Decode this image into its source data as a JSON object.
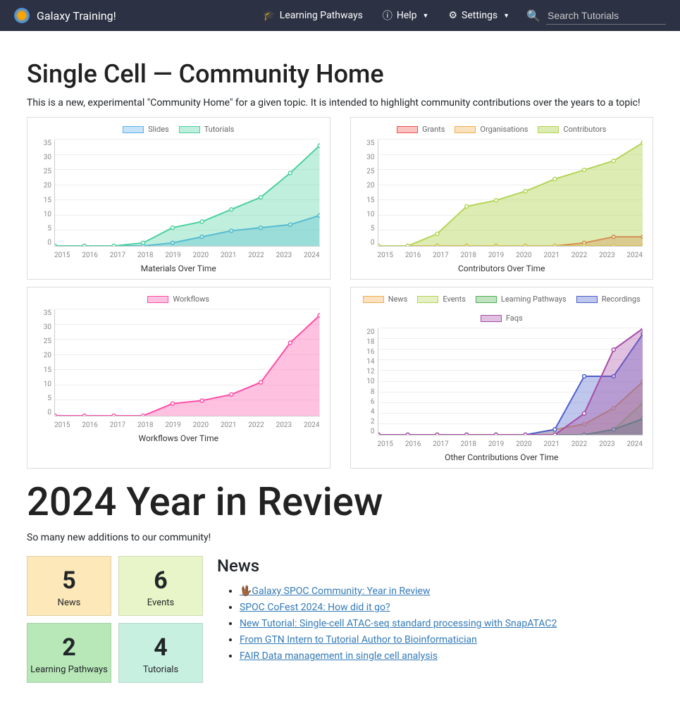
{
  "nav": {
    "brand": "Galaxy Training!",
    "pathways": "Learning Pathways",
    "help": "Help",
    "settings": "Settings",
    "search_placeholder": "Search Tutorials"
  },
  "page": {
    "title": "Single Cell — Community Home",
    "intro": "This is a new, experimental \"Community Home\" for a given topic. It is intended to highlight community contributions over the years to a topic!"
  },
  "chart_data": [
    {
      "type": "area",
      "title": "Materials Over Time",
      "x": [
        2015,
        2016,
        2017,
        2018,
        2019,
        2020,
        2021,
        2022,
        2023,
        2024
      ],
      "ymax": 35,
      "series": [
        {
          "name": "Slides",
          "color": "#5bb0e8",
          "fill": "rgba(91,176,232,0.35)",
          "values": [
            0,
            0,
            0,
            0,
            1,
            3,
            5,
            6,
            7,
            10
          ]
        },
        {
          "name": "Tutorials",
          "color": "#4bd1a0",
          "fill": "rgba(75,209,160,0.35)",
          "values": [
            0,
            0,
            0,
            1,
            6,
            8,
            12,
            16,
            24,
            33
          ]
        }
      ]
    },
    {
      "type": "area",
      "title": "Contributors Over Time",
      "x": [
        2015,
        2016,
        2017,
        2018,
        2019,
        2020,
        2021,
        2022,
        2023,
        2024
      ],
      "ymax": 35,
      "series": [
        {
          "name": "Grants",
          "color": "#ef5350",
          "fill": "rgba(239,83,80,0.35)",
          "values": [
            0,
            0,
            0,
            0,
            0,
            0,
            0,
            1,
            3,
            3
          ]
        },
        {
          "name": "Organisations",
          "color": "#f0ad4e",
          "fill": "rgba(240,173,78,0.35)",
          "values": [
            0,
            0,
            0,
            0,
            0,
            0,
            0,
            0,
            0,
            0
          ]
        },
        {
          "name": "Contributors",
          "color": "#b4d455",
          "fill": "rgba(180,212,85,0.45)",
          "values": [
            0,
            0,
            4,
            13,
            15,
            18,
            22,
            25,
            28,
            34
          ]
        }
      ]
    },
    {
      "type": "area",
      "title": "Workflows Over Time",
      "x": [
        2015,
        2016,
        2017,
        2018,
        2019,
        2020,
        2021,
        2022,
        2023,
        2024
      ],
      "ymax": 35,
      "series": [
        {
          "name": "Workflows",
          "color": "#ff4da6",
          "fill": "rgba(255,77,166,0.35)",
          "values": [
            0,
            0,
            0,
            0,
            4,
            5,
            7,
            11,
            24,
            33
          ]
        }
      ]
    },
    {
      "type": "area",
      "title": "Other Contributions Over Time",
      "x": [
        2015,
        2016,
        2017,
        2018,
        2019,
        2020,
        2021,
        2022,
        2023,
        2024
      ],
      "ymax": 20,
      "series": [
        {
          "name": "News",
          "color": "#f0ad4e",
          "fill": "rgba(240,173,78,0.35)",
          "values": [
            0,
            0,
            0,
            0,
            0,
            0,
            1,
            2,
            5,
            10
          ]
        },
        {
          "name": "Events",
          "color": "#b4d455",
          "fill": "rgba(180,212,85,0.35)",
          "values": [
            0,
            0,
            0,
            0,
            0,
            0,
            0,
            0,
            1,
            6
          ]
        },
        {
          "name": "Learning Pathways",
          "color": "#4caf50",
          "fill": "rgba(76,175,80,0.35)",
          "values": [
            0,
            0,
            0,
            0,
            0,
            0,
            0,
            0,
            1,
            3
          ]
        },
        {
          "name": "Recordings",
          "color": "#4a5ecc",
          "fill": "rgba(74,94,204,0.35)",
          "values": [
            0,
            0,
            0,
            0,
            0,
            0,
            1,
            11,
            11,
            19
          ]
        },
        {
          "name": "Faqs",
          "color": "#a64ca6",
          "fill": "rgba(166,76,166,0.35)",
          "values": [
            0,
            0,
            0,
            0,
            0,
            0,
            0,
            4,
            16,
            20
          ]
        }
      ]
    }
  ],
  "review": {
    "title": "2024 Year in Review",
    "subtext": "So many new additions to our community!",
    "stats": [
      {
        "num": "5",
        "label": "News",
        "bg": "#fce8b8"
      },
      {
        "num": "6",
        "label": "Events",
        "bg": "#e8f5c8"
      },
      {
        "num": "2",
        "label": "Learning Pathways",
        "bg": "#b8e8b8"
      },
      {
        "num": "4",
        "label": "Tutorials",
        "bg": "#c8f0e0"
      }
    ],
    "news_heading": "News",
    "news_items": [
      "🖖🏾Galaxy SPOC Community: Year in Review",
      "SPOC CoFest 2024: How did it go?",
      "New Tutorial: Single-cell ATAC-seq standard processing with SnapATAC2",
      "From GTN Intern to Tutorial Author to Bioinformatician",
      "FAIR Data management in single cell analysis"
    ]
  }
}
